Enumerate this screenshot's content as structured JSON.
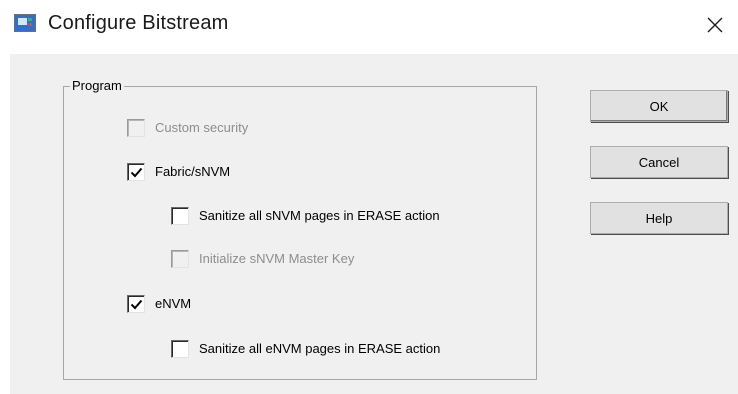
{
  "window": {
    "title": "Configure Bitstream",
    "app_icon": "app-window-icon",
    "close_icon": "close-icon"
  },
  "program_group": {
    "legend": "Program",
    "options": [
      {
        "label": "Custom security",
        "checked": false,
        "enabled": false
      },
      {
        "label": "Fabric/sNVM",
        "checked": true,
        "enabled": true
      },
      {
        "label": "Sanitize all  sNVM pages in ERASE action",
        "checked": false,
        "enabled": true
      },
      {
        "label": "Initialize sNVM Master Key",
        "checked": false,
        "enabled": false
      },
      {
        "label": "eNVM",
        "checked": true,
        "enabled": true
      },
      {
        "label": "Sanitize all  eNVM pages in ERASE action",
        "checked": false,
        "enabled": true
      }
    ]
  },
  "buttons": {
    "ok": "OK",
    "cancel": "Cancel",
    "help": "Help"
  }
}
